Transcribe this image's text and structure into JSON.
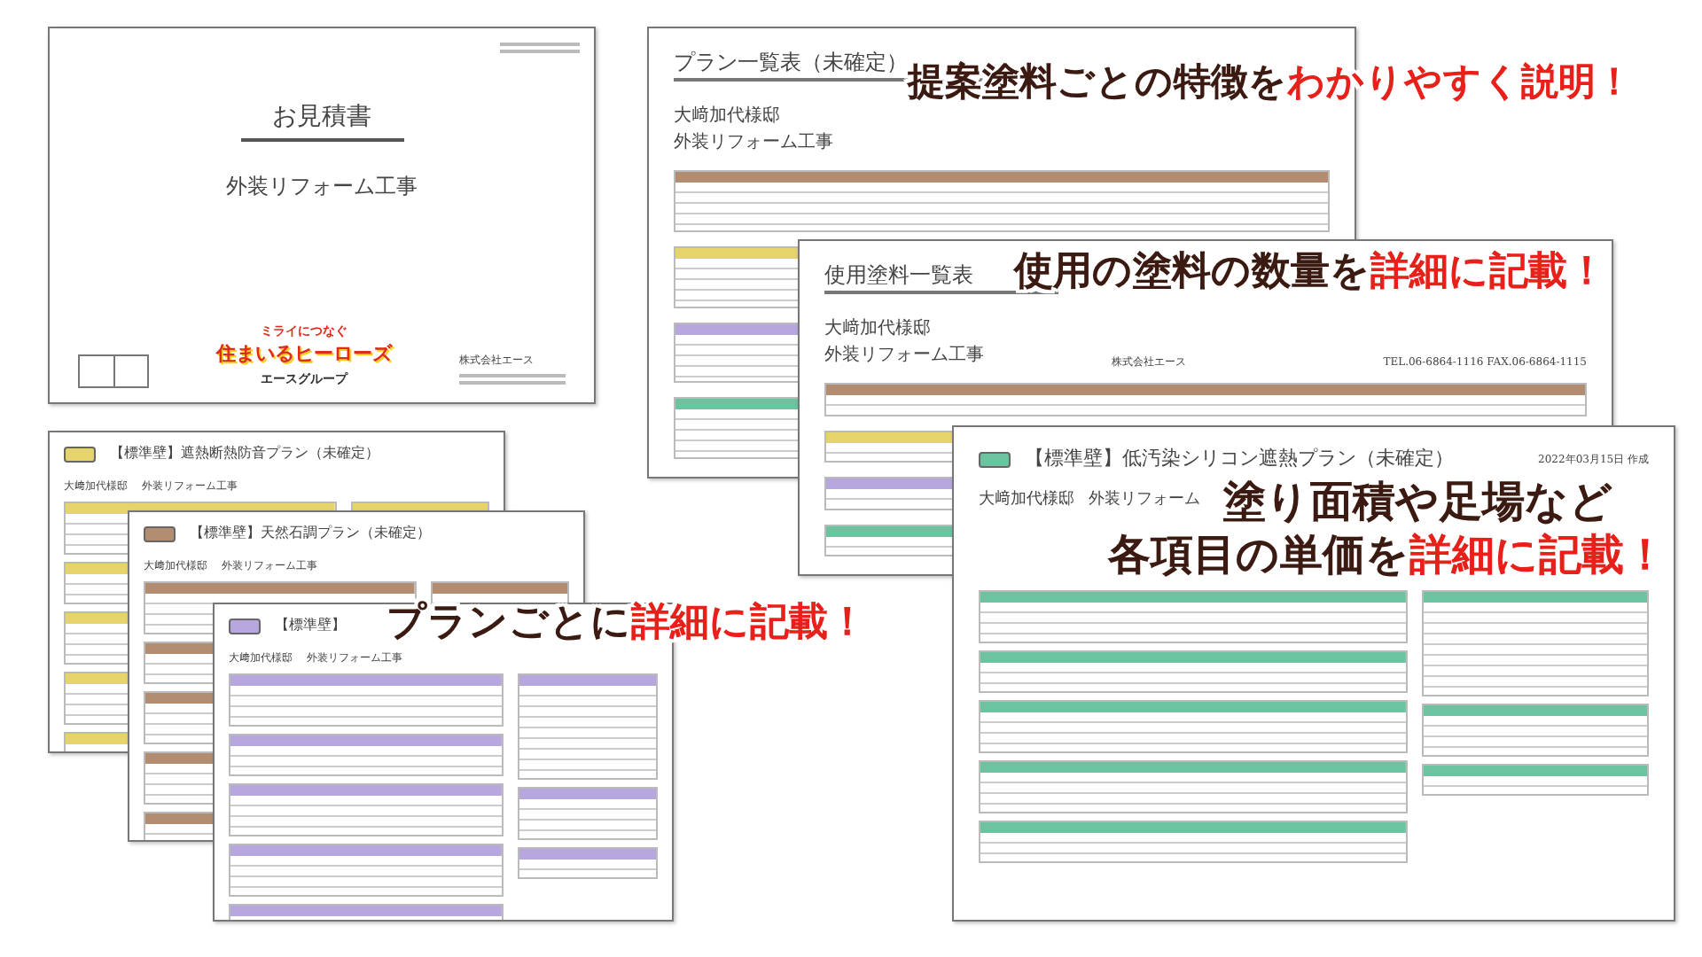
{
  "documents": [
    {
      "kind": "cover",
      "title": "お見積書",
      "project": "外装リフォーム工事",
      "logo_tagline": "ミライにつなぐ",
      "logo": "住まいるヒーローズ",
      "logo_group": "エースグループ",
      "company": "株式会社エース"
    },
    {
      "kind": "plan",
      "color": "#e6d36a",
      "title": "【標準壁】遮熱断熱防音プラン（未確定）",
      "client": "大﨑加代様邸",
      "project": "外装リフォーム工事"
    },
    {
      "kind": "plan",
      "color": "#b38d72",
      "title": "【標準壁】天然石調プラン（未確定）",
      "client": "大﨑加代様邸",
      "project": "外装リフォーム工事"
    },
    {
      "kind": "plan",
      "color": "#b8a6de",
      "title": "【標準壁】",
      "client": "大﨑加代様邸",
      "project": "外装リフォーム工事"
    },
    {
      "kind": "list",
      "color": "#b38d72",
      "title": "プラン一覧表（未確定）",
      "client": "大﨑加代様邸",
      "project": "外装リフォーム工事"
    },
    {
      "kind": "list",
      "color": "#b38d72",
      "title": "使用塗料一覧表",
      "client": "大﨑加代様邸",
      "project": "外装リフォーム工事",
      "company": "株式会社エース",
      "tel": "TEL.06-6864-1116 FAX.06-6864-1115"
    },
    {
      "kind": "plan",
      "color": "#6cc3a0",
      "title": "【標準壁】低汚染シリコン遮熱プラン（未確定）",
      "date": "2022年03月15日 作成",
      "client": "大﨑加代様邸",
      "project": "外装リフォーム"
    }
  ],
  "captions": [
    {
      "lines": [
        [
          {
            "text": "提案塗料ごとの特徴を",
            "highlight": false
          },
          {
            "text": "わかりやすく説明！",
            "highlight": true
          }
        ]
      ]
    },
    {
      "lines": [
        [
          {
            "text": "使用の塗料の数量を",
            "highlight": false
          },
          {
            "text": "詳細に記載！",
            "highlight": true
          }
        ]
      ]
    },
    {
      "lines": [
        [
          {
            "text": "塗り面積や足場など",
            "highlight": false
          }
        ],
        [
          {
            "text": "各項目の単価を",
            "highlight": false
          },
          {
            "text": "詳細に記載！",
            "highlight": true
          }
        ]
      ]
    },
    {
      "lines": [
        [
          {
            "text": "プランごとに",
            "highlight": false
          },
          {
            "text": "詳細に記載！",
            "highlight": true
          }
        ]
      ]
    }
  ]
}
